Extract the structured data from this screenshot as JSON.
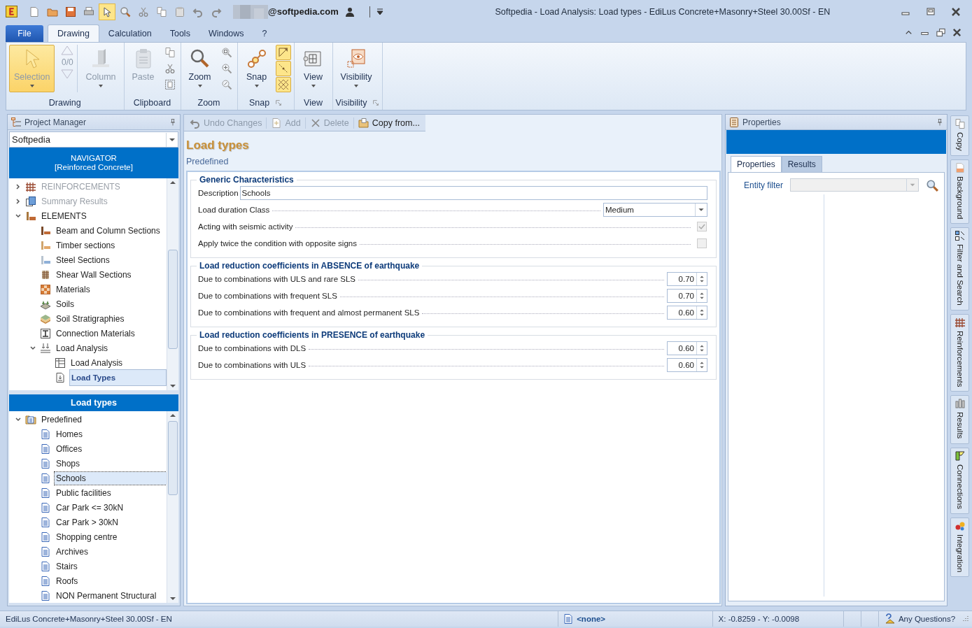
{
  "window": {
    "title": "Softpedia -  Load Analysis: Load types - EdiLus Concrete+Masonry+Steel 30.00Sf - EN",
    "account": "@softpedia.com"
  },
  "quick_tools": [
    {
      "kind": "new",
      "selected": false
    },
    {
      "kind": "open",
      "selected": false
    },
    {
      "kind": "save",
      "selected": false
    },
    {
      "kind": "print",
      "selected": false
    },
    {
      "kind": "pointer",
      "selected": true
    },
    {
      "kind": "search",
      "selected": false
    },
    {
      "kind": "cut",
      "selected": false
    },
    {
      "kind": "copy",
      "selected": false
    },
    {
      "kind": "paste",
      "selected": false
    },
    {
      "kind": "undo",
      "selected": false
    },
    {
      "kind": "redo",
      "selected": false
    }
  ],
  "menu_tabs": [
    {
      "label": "File",
      "kind": "file",
      "selected": false
    },
    {
      "label": "Drawing",
      "kind": "tab",
      "selected": true
    },
    {
      "label": "Calculation",
      "kind": "tab",
      "selected": false
    },
    {
      "label": "Tools",
      "kind": "tab",
      "selected": false
    },
    {
      "label": "Windows",
      "kind": "tab",
      "selected": false
    },
    {
      "label": "?",
      "kind": "tab",
      "selected": false
    }
  ],
  "ribbon": [
    {
      "title": "Drawing",
      "launcher": false,
      "items": [
        {
          "kind": "pointer",
          "label": "Selection",
          "active": true,
          "disabled": true,
          "dropdown": true
        },
        {
          "kind": "counter",
          "text": "0/0"
        },
        {
          "kind": "column",
          "label": "Column",
          "active": false,
          "disabled": true,
          "dropdown": true
        }
      ]
    },
    {
      "title": "Clipboard",
      "launcher": false,
      "items": [
        {
          "kind": "paste",
          "label": "Paste",
          "active": false,
          "disabled": true,
          "dropdown": false
        },
        {
          "kind": "stack",
          "icons": [
            {
              "kind": "copy",
              "active": false
            },
            {
              "kind": "cut",
              "active": false
            },
            {
              "kind": "selcopy",
              "active": false
            }
          ]
        }
      ]
    },
    {
      "title": "Zoom",
      "launcher": false,
      "items": [
        {
          "kind": "zoom",
          "label": "Zoom",
          "active": false,
          "disabled": false,
          "dropdown": true
        },
        {
          "kind": "stack",
          "icons": [
            {
              "kind": "zoomwin",
              "active": false
            },
            {
              "kind": "zoomall",
              "active": false
            },
            {
              "kind": "zoomprev",
              "active": false
            }
          ]
        }
      ]
    },
    {
      "title": "Snap",
      "launcher": true,
      "items": [
        {
          "kind": "snap",
          "label": "Snap",
          "active": false,
          "disabled": false,
          "dropdown": true
        },
        {
          "kind": "stack",
          "icons": [
            {
              "kind": "snapcorner",
              "active": true
            },
            {
              "kind": "snapline",
              "active": true
            },
            {
              "kind": "snapgrid",
              "active": true
            }
          ]
        }
      ]
    },
    {
      "title": "View",
      "launcher": false,
      "items": [
        {
          "kind": "view",
          "label": "View",
          "active": false,
          "disabled": false,
          "dropdown": true
        }
      ]
    },
    {
      "title": "Visibility",
      "launcher": true,
      "items": [
        {
          "kind": "visibility",
          "label": "Visibility",
          "active": false,
          "disabled": false,
          "dropdown": true
        }
      ]
    }
  ],
  "project_manager": {
    "title": "Project Manager",
    "project": "Softpedia",
    "navigator": "NAVIGATOR",
    "navigator_mode": "[Reinforced Concrete]",
    "tree": [
      {
        "label": "REINFORCEMENTS",
        "kind": "rebar",
        "expanded": false,
        "disabled": true,
        "selected": false
      },
      {
        "label": "Summary Results",
        "kind": "summary",
        "expanded": false,
        "disabled": true,
        "selected": false
      },
      {
        "label": "ELEMENTS",
        "kind": "elements",
        "expanded": true,
        "disabled": false,
        "selected": false,
        "children": [
          {
            "label": "Beam and Column Sections",
            "kind": "beam",
            "disabled": false,
            "selected": false
          },
          {
            "label": "Timber sections",
            "kind": "timber",
            "disabled": false,
            "selected": false
          },
          {
            "label": "Steel Sections",
            "kind": "steel",
            "disabled": false,
            "selected": false
          },
          {
            "label": "Shear Wall Sections",
            "kind": "shear",
            "disabled": false,
            "selected": false
          },
          {
            "label": "Materials",
            "kind": "materials",
            "disabled": false,
            "selected": false
          },
          {
            "label": "Soils",
            "kind": "soils",
            "disabled": false,
            "selected": false
          },
          {
            "label": "Soil Stratigraphies",
            "kind": "strata",
            "disabled": false,
            "selected": false
          },
          {
            "label": "Connection Materials",
            "kind": "connection",
            "disabled": false,
            "selected": false
          },
          {
            "label": "Load Analysis",
            "kind": "load",
            "expanded": true,
            "disabled": false,
            "selected": false,
            "children": [
              {
                "label": "Load Analysis",
                "kind": "table",
                "disabled": false,
                "selected": false
              },
              {
                "label": "Load Types",
                "kind": "loaddoc",
                "disabled": false,
                "selected": true
              }
            ]
          }
        ]
      }
    ]
  },
  "load_types_panel": {
    "title": "Load types",
    "tree": [
      {
        "label": "Predefined",
        "kind": "folderdoc",
        "expanded": true,
        "selected": false,
        "children": [
          {
            "label": "Homes",
            "kind": "doc",
            "selected": false
          },
          {
            "label": "Offices",
            "kind": "doc",
            "selected": false
          },
          {
            "label": "Shops",
            "kind": "doc",
            "selected": false
          },
          {
            "label": "Schools",
            "kind": "doc",
            "selected": true
          },
          {
            "label": "Public facilities",
            "kind": "doc",
            "selected": false
          },
          {
            "label": "Car Park <= 30kN",
            "kind": "doc",
            "selected": false
          },
          {
            "label": "Car Park > 30kN",
            "kind": "doc",
            "selected": false
          },
          {
            "label": "Shopping centre",
            "kind": "doc",
            "selected": false
          },
          {
            "label": "Archives",
            "kind": "doc",
            "selected": false
          },
          {
            "label": "Stairs",
            "kind": "doc",
            "selected": false
          },
          {
            "label": "Roofs",
            "kind": "doc",
            "selected": false
          },
          {
            "label": "NON Permanent Structural",
            "kind": "doc",
            "selected": false
          }
        ]
      }
    ]
  },
  "editor": {
    "toolbar": [
      {
        "label": "Undo Changes",
        "kind": "undo",
        "disabled": true
      },
      {
        "label": "Add",
        "kind": "add",
        "disabled": true
      },
      {
        "label": "Delete",
        "kind": "delete",
        "disabled": true
      },
      {
        "label": "Copy from...",
        "kind": "copyfrom",
        "disabled": false
      }
    ],
    "heading": "Load types",
    "subheading": "Predefined",
    "sections": [
      {
        "title": "Generic Characteristics",
        "rows": [
          {
            "kind": "text",
            "label": "Description",
            "value": "Schools"
          },
          {
            "kind": "select",
            "label": "Load duration Class",
            "value": "Medium"
          },
          {
            "kind": "checkbox",
            "label": "Acting with seismic activity",
            "checked": true,
            "disabled": true
          },
          {
            "kind": "checkbox",
            "label": "Apply twice the condition with opposite signs",
            "checked": false,
            "disabled": true
          }
        ]
      },
      {
        "title": "Load reduction coefficients in ABSENCE of earthquake",
        "rows": [
          {
            "kind": "spin",
            "label": "Due to combinations with ULS and rare SLS",
            "value": "0.70"
          },
          {
            "kind": "spin",
            "label": "Due to combinations with frequent SLS",
            "value": "0.70"
          },
          {
            "kind": "spin",
            "label": "Due to combinations with frequent and almost permanent SLS",
            "value": "0.60"
          }
        ]
      },
      {
        "title": "Load reduction coefficients in PRESENCE of earthquake",
        "rows": [
          {
            "kind": "spin",
            "label": "Due to combinations with DLS",
            "value": "0.60"
          },
          {
            "kind": "spin",
            "label": "Due to combinations with ULS",
            "value": "0.60"
          }
        ]
      }
    ]
  },
  "properties": {
    "title": "Properties",
    "tabs": [
      {
        "label": "Properties",
        "selected": true
      },
      {
        "label": "Results",
        "selected": false
      }
    ],
    "filter_label": "Entity filter"
  },
  "side_tabs": [
    {
      "label": "Copy",
      "kind": "copy"
    },
    {
      "label": "Background",
      "kind": "background"
    },
    {
      "label": "Filter and Search",
      "kind": "filter"
    },
    {
      "label": "Reinforcements",
      "kind": "rebar"
    },
    {
      "label": "Results",
      "kind": "results"
    },
    {
      "label": "Connections",
      "kind": "connections"
    },
    {
      "label": "Integration",
      "kind": "integration"
    }
  ],
  "status_bar": {
    "product": "EdiLus Concrete+Masonry+Steel 30.00Sf - EN",
    "layer": "<none>",
    "coordinates": "X: -0.8259 - Y: -0.0098",
    "help": "Any Questions?"
  }
}
